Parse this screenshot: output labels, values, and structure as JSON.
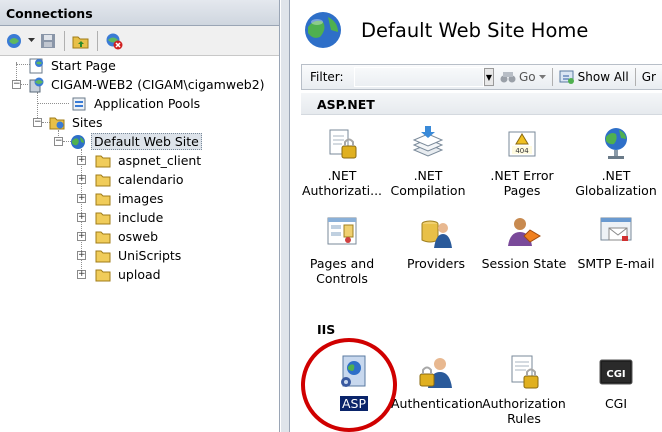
{
  "connections": {
    "title": "Connections",
    "toolbar": [
      "connect-icon",
      "save-icon",
      "up-folder-icon",
      "delete-connection-icon"
    ]
  },
  "tree": {
    "start_page": "Start Page",
    "server": "CIGAM-WEB2 (CIGAM\\cigamweb2)",
    "app_pools": "Application Pools",
    "sites": "Sites",
    "default_site": "Default Web Site",
    "folders": [
      "aspnet_client",
      "calendario",
      "images",
      "include",
      "osweb",
      "UniScripts",
      "upload"
    ]
  },
  "main": {
    "title": "Default Web Site Home",
    "filter": {
      "label": "Filter:",
      "value": "",
      "go_label": "Go",
      "show_all_label": "Show All",
      "group_label_partial": "Gr"
    },
    "groups": [
      {
        "name": "ASP.NET",
        "features": [
          {
            "label": ".NET Authorizati...",
            "icon": "net-authorization-icon"
          },
          {
            "label": ".NET Compilation",
            "icon": "net-compilation-icon"
          },
          {
            "label": ".NET Error Pages",
            "icon": "net-error-pages-icon"
          },
          {
            "label": ".NET Globalization",
            "icon": "net-globalization-icon"
          },
          {
            "label": "Pages and Controls",
            "icon": "pages-controls-icon"
          },
          {
            "label": "Providers",
            "icon": "providers-icon"
          },
          {
            "label": "Session State",
            "icon": "session-state-icon"
          },
          {
            "label": "SMTP E-mail",
            "icon": "smtp-email-icon"
          }
        ]
      },
      {
        "name": "IIS",
        "features": [
          {
            "label": "ASP",
            "icon": "asp-icon",
            "selected": true
          },
          {
            "label": "Authentication",
            "icon": "authentication-icon"
          },
          {
            "label": "Authorization Rules",
            "icon": "authorization-rules-icon"
          },
          {
            "label": "CGI",
            "icon": "cgi-icon"
          }
        ]
      }
    ],
    "highlight_color": "#d00000"
  }
}
